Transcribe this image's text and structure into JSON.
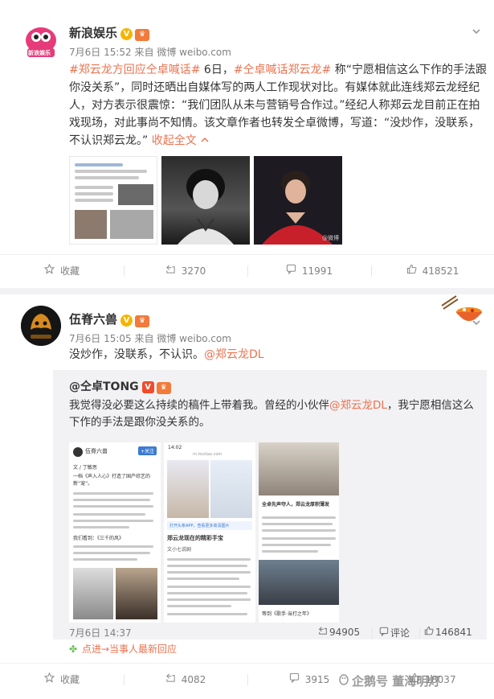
{
  "post1": {
    "author": "新浪娱乐",
    "avatar_text": "新浪娱乐",
    "verified_icon": "verified-v-icon",
    "level_icon": "member-crown-icon",
    "more_icon": "chevron-down-icon",
    "time": "7月6日 15:52",
    "source_prefix": "来自",
    "source": "微博 weibo.com",
    "text_tag1": "#郑云龙方回应仝卓喊话#",
    "text_a": " 6日，",
    "text_tag2": "#仝卓喊话郑云龙#",
    "text_b": " 称“宁愿相信这么下作的手法跟你没关系”，同时还晒出自媒体写的两人工作现状对比。有媒体就此连线郑云龙经纪人，对方表示很震惊：“我们团队从未与营销号合作过。”经纪人称郑云龙目前正在拍戏现场，对此事尚不知情。该文章作者也转发仝卓微博，写道：“没炒作，没联系，不认识郑云龙。”",
    "collapse": "收起全文",
    "collapse_icon": "chevron-up-icon",
    "thumb3_watermark": "@微博",
    "actions": {
      "favorite": "收藏",
      "repost": "3270",
      "comment": "11991",
      "like": "418521"
    }
  },
  "post2": {
    "author": "伍脊六兽",
    "avatar_text": "伍脊六兽",
    "verified_icon": "verified-v-icon",
    "level_icon": "member-crown-icon",
    "more_icon": "chevron-down-icon",
    "time": "7月6日 15:05",
    "source_prefix": "来自",
    "source": "微博 weibo.com",
    "text_plain": "没炒作，没联系，不认识。",
    "text_mention": "@郑云龙DL",
    "repost": {
      "author": "@仝卓TONG",
      "text_a": "我觉得没必要这么持续的稿件上带着我。曾经的小伙伴",
      "mention": "@郑云龙DL",
      "text_b": "，我宁愿相信这么下作的手法是跟你没关系的。",
      "img1_author": "伍脊六兽",
      "img1_follow": "+关注",
      "img1_byline": "文 / 丁敏思",
      "img1_p1": "一档《声入人心》打造了国产综艺的新“宠”。",
      "img1_p2": "我们看到：《三千的风》",
      "img2_status": "14:02",
      "img2_url": "m.toutiao.com",
      "img2_banner": "打开头条APP，查看更多高清图片",
      "img2_title": "郑云龙现在的精彩手宝",
      "img2_author": "文小七说剧",
      "img3_title": "全卓先声夺人，郑云龙厚积薄发",
      "img3_caption": "等到《歌手·当打之年》",
      "time": "7月6日 14:37",
      "repost_count": "94905",
      "comment_label": "评论",
      "like_count": "146841"
    },
    "hot_comment": "点进→当事人最新回应",
    "hot_icon": "clover-icon",
    "actions": {
      "favorite": "收藏",
      "repost": "4082",
      "comment": "3915",
      "like": "18037"
    },
    "badge_icon": "hotpot-badge-icon"
  },
  "watermark": "企鹅号 董海明灯"
}
